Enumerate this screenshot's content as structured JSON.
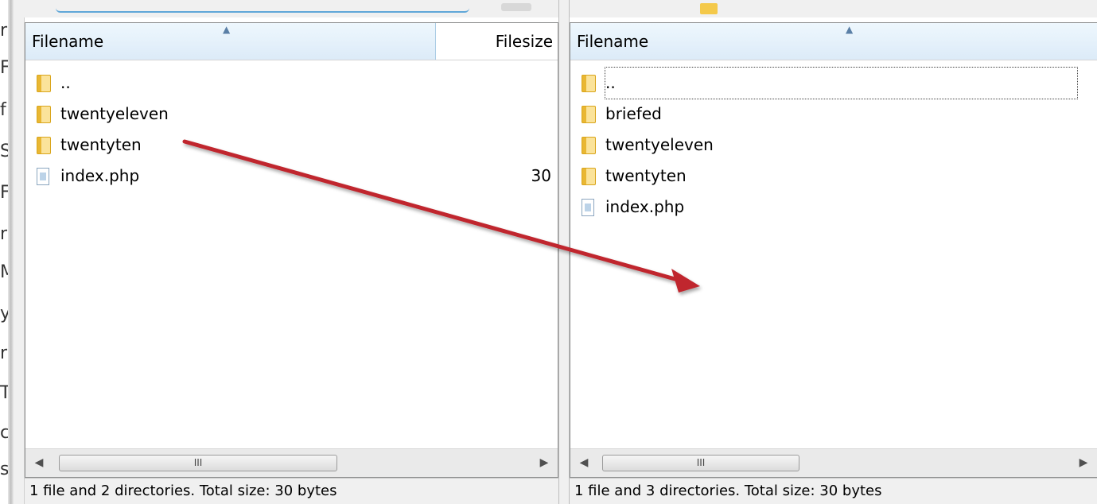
{
  "left_pane": {
    "columns": {
      "filename": "Filename",
      "filesize": "Filesize"
    },
    "rows": [
      {
        "name": "..",
        "type": "folder",
        "size": ""
      },
      {
        "name": "twentyeleven",
        "type": "folder",
        "size": ""
      },
      {
        "name": "twentyten",
        "type": "folder",
        "size": ""
      },
      {
        "name": "index.php",
        "type": "file",
        "size": "30"
      }
    ],
    "scroll_grip": "III",
    "status": "1 file and 2 directories. Total size: 30 bytes"
  },
  "right_pane": {
    "columns": {
      "filename": "Filename"
    },
    "rows": [
      {
        "name": "..",
        "type": "folder"
      },
      {
        "name": "briefed",
        "type": "folder"
      },
      {
        "name": "twentyeleven",
        "type": "folder"
      },
      {
        "name": "twentyten",
        "type": "folder"
      },
      {
        "name": "index.php",
        "type": "file"
      }
    ],
    "scroll_grip": "III",
    "status": "1 file and 3 directories. Total size: 30 bytes"
  },
  "scroll_arrows": {
    "left": "◀",
    "right": "▶"
  },
  "sort_arrow": "▲",
  "left_edge_letters": [
    "r",
    "F",
    "f",
    "S",
    "F",
    "r",
    "M",
    "y",
    "r",
    "T",
    "c",
    "s"
  ],
  "annotation": {
    "color": "#c0272d",
    "icon": "red-arrow-icon"
  },
  "colors": {
    "header_highlight": "#dcebf8",
    "folder": "#f4c94a"
  }
}
